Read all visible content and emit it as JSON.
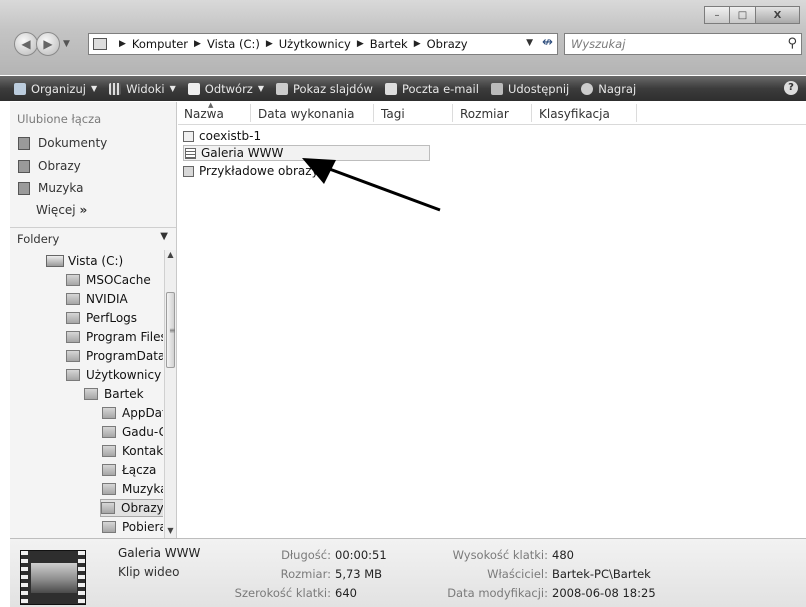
{
  "window": {
    "buttons": {
      "minimize": "–",
      "maximize": "□",
      "close": "X"
    }
  },
  "nav": {
    "back_icon": "arrow-left-icon",
    "forward_icon": "arrow-right-icon"
  },
  "address": {
    "crumbs": [
      "Komputer",
      "Vista (C:)",
      "Użytkownicy",
      "Bartek",
      "Obrazy"
    ]
  },
  "search": {
    "placeholder": "Wyszukaj"
  },
  "toolbar": {
    "items": [
      {
        "label": "Organizuj",
        "dropdown": true
      },
      {
        "label": "Widoki",
        "dropdown": true
      },
      {
        "label": "Odtwórz",
        "dropdown": true
      },
      {
        "label": "Pokaz slajdów",
        "dropdown": false
      },
      {
        "label": "Poczta e-mail",
        "dropdown": false
      },
      {
        "label": "Udostępnij",
        "dropdown": false
      },
      {
        "label": "Nagraj",
        "dropdown": false
      }
    ],
    "help": "?"
  },
  "sidebar": {
    "favorites_title": "Ulubione łącza",
    "favorites": [
      "Dokumenty",
      "Obrazy",
      "Muzyka"
    ],
    "more": "Więcej",
    "folders_title": "Foldery",
    "tree": [
      {
        "label": "Vista (C:)",
        "level": 1,
        "type": "drive"
      },
      {
        "label": "MSOCache",
        "level": 2
      },
      {
        "label": "NVIDIA",
        "level": 2
      },
      {
        "label": "PerfLogs",
        "level": 2
      },
      {
        "label": "Program Files",
        "level": 2
      },
      {
        "label": "ProgramData",
        "level": 2
      },
      {
        "label": "Użytkownicy",
        "level": 2
      },
      {
        "label": "Bartek",
        "level": 3
      },
      {
        "label": "AppData",
        "level": 4
      },
      {
        "label": "Gadu-Gadu",
        "level": 4
      },
      {
        "label": "Kontakty",
        "level": 4
      },
      {
        "label": "Łącza",
        "level": 4
      },
      {
        "label": "Muzyka",
        "level": 4
      },
      {
        "label": "Obrazy",
        "level": 4,
        "selected": true
      },
      {
        "label": "Pobierane",
        "level": 4
      }
    ]
  },
  "columns": [
    "Nazwa",
    "Data wykonania",
    "Tagi",
    "Rozmiar",
    "Klasyfikacja"
  ],
  "files": [
    {
      "name": "coexistb-1",
      "icon": "text-file-icon"
    },
    {
      "name": "Galeria WWW",
      "icon": "video-file-icon",
      "selected": true
    },
    {
      "name": "Przykładowe obrazy",
      "icon": "shortcut-folder-icon"
    }
  ],
  "details": {
    "name": "Galeria WWW",
    "type": "Klip wideo",
    "fields": [
      {
        "label": "Długość:",
        "value": "00:00:51"
      },
      {
        "label": "Rozmiar:",
        "value": "5,73 MB"
      },
      {
        "label": "Szerokość klatki:",
        "value": "640"
      },
      {
        "label": "Wysokość klatki:",
        "value": "480"
      },
      {
        "label": "Właściciel:",
        "value": "Bartek-PC\\Bartek"
      },
      {
        "label": "Data modyfikacji:",
        "value": "2008-06-08 18:25"
      }
    ]
  }
}
